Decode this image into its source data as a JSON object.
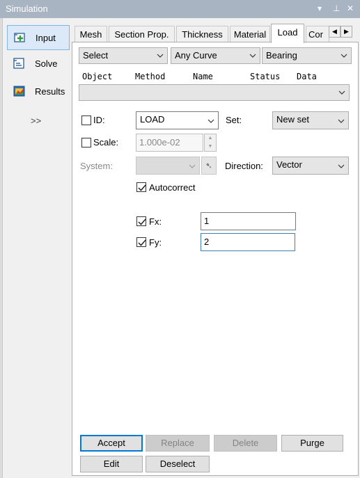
{
  "window": {
    "title": "Simulation",
    "controls": {
      "menu": "▾",
      "pin": "⊥",
      "close": "✕"
    }
  },
  "sidebar": {
    "items": [
      {
        "label": "Input",
        "icon": "input-icon",
        "active": true
      },
      {
        "label": "Solve",
        "icon": "solve-icon",
        "active": false
      },
      {
        "label": "Results",
        "icon": "results-icon",
        "active": false
      }
    ],
    "more": ">>"
  },
  "tabs": {
    "items": [
      "Mesh",
      "Section Prop.",
      "Thickness",
      "Material",
      "Load",
      "Cor"
    ],
    "active": "Load",
    "scroll_left": "◀",
    "scroll_right": "▶"
  },
  "selectors": {
    "mode": "Select",
    "entity": "Any Curve",
    "load_type": "Bearing"
  },
  "columns": [
    "Object",
    "Method",
    "Name",
    "Status",
    "Data"
  ],
  "object_list": {
    "value": ""
  },
  "form": {
    "id": {
      "label": "ID:",
      "checked": false,
      "value": "LOAD"
    },
    "set": {
      "label": "Set:",
      "value": "New set"
    },
    "scale": {
      "label": "Scale:",
      "checked": false,
      "value": "1.000e-02"
    },
    "system": {
      "label": "System:",
      "value": ""
    },
    "direction": {
      "label": "Direction:",
      "value": "Vector"
    },
    "autocorrect": {
      "label": "Autocorrect",
      "checked": true
    },
    "fx": {
      "label": "Fx:",
      "checked": true,
      "value": "1"
    },
    "fy": {
      "label": "Fy:",
      "checked": true,
      "value": "2"
    }
  },
  "buttons": {
    "accept": "Accept",
    "replace": "Replace",
    "delete": "Delete",
    "purge": "Purge",
    "edit": "Edit",
    "deselect": "Deselect"
  },
  "colors": {
    "titlebar": "#a9b4c2",
    "active_side": "#dbe9f8",
    "active_side_border": "#7eb4ea",
    "focus_border": "#3c7fb1",
    "default_button_border": "#0078d7"
  }
}
